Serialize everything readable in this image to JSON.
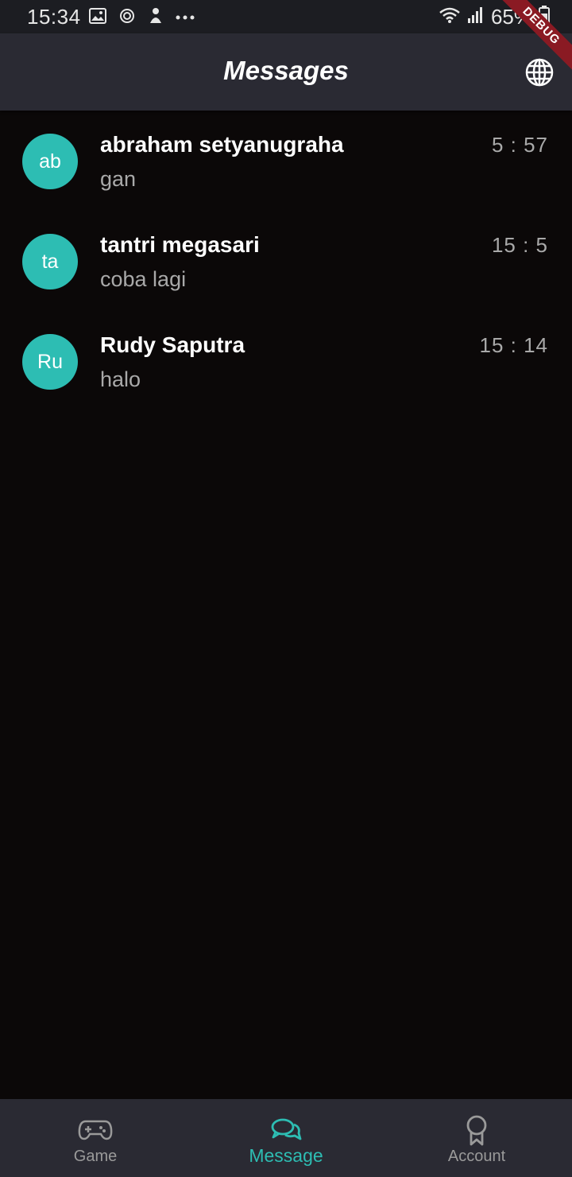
{
  "status_bar": {
    "time": "15:34",
    "battery": "65%",
    "icons": [
      "image-icon",
      "sync-icon",
      "person-icon",
      "more-dots-icon",
      "wifi-icon",
      "signal-icon",
      "battery-icon"
    ]
  },
  "debug_banner": "DEBUG",
  "app_bar": {
    "title": "Messages",
    "action_icon": "globe-icon"
  },
  "messages": [
    {
      "initials": "ab",
      "name": "abraham setyanugraha",
      "preview": "gan",
      "time": "5 : 57"
    },
    {
      "initials": "ta",
      "name": "tantri megasari",
      "preview": "coba lagi",
      "time": "15 : 5"
    },
    {
      "initials": "Ru",
      "name": "Rudy Saputra",
      "preview": "halo",
      "time": "15 : 14"
    }
  ],
  "bottom_nav": {
    "items": [
      {
        "label": "Game",
        "icon": "gamepad-icon"
      },
      {
        "label": "Message",
        "icon": "chat-bubbles-icon"
      },
      {
        "label": "Account",
        "icon": "award-icon"
      }
    ],
    "active": "Message"
  },
  "colors": {
    "accent": "#2dbdb3",
    "background": "#0b0808",
    "bar": "#2a2a33",
    "debug": "#8a1a23",
    "secondary_text": "#a9a9a9"
  }
}
